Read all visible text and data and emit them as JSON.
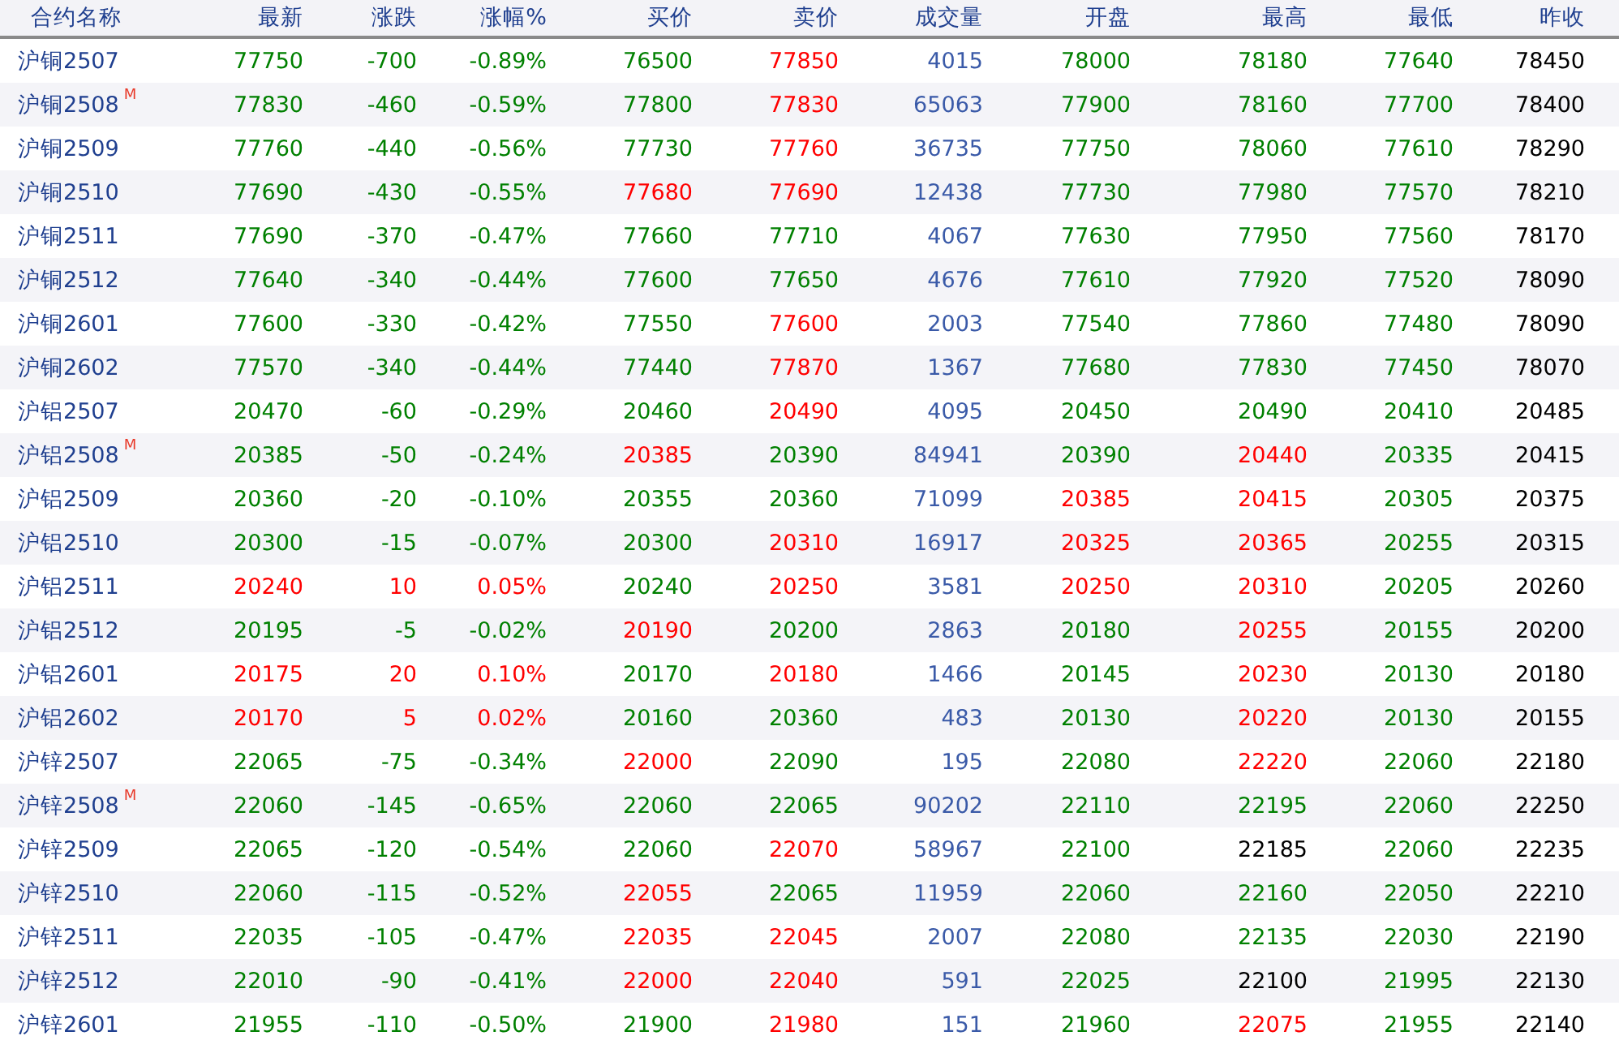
{
  "table": {
    "columns": [
      {
        "label": "合约名称",
        "kind": "name"
      },
      {
        "label": "最新",
        "kind": "value"
      },
      {
        "label": "涨跌",
        "kind": "value"
      },
      {
        "label": "涨幅%",
        "kind": "value"
      },
      {
        "label": "买价",
        "kind": "value"
      },
      {
        "label": "卖价",
        "kind": "value"
      },
      {
        "label": "成交量",
        "kind": "value"
      },
      {
        "label": "开盘",
        "kind": "value"
      },
      {
        "label": "最高",
        "kind": "value"
      },
      {
        "label": "最低",
        "kind": "value"
      },
      {
        "label": "昨收",
        "kind": "value"
      }
    ],
    "rows": [
      {
        "cells": [
          {
            "text": "沪铜2507",
            "color": "#1f3f8f"
          },
          {
            "text": "77750",
            "color": "#008000"
          },
          {
            "text": "-700",
            "color": "#008000"
          },
          {
            "text": "-0.89%",
            "color": "#008000"
          },
          {
            "text": "76500",
            "color": "#008000"
          },
          {
            "text": "77850",
            "color": "#ff0000"
          },
          {
            "text": "4015",
            "color": "#3a5aa8"
          },
          {
            "text": "78000",
            "color": "#008000"
          },
          {
            "text": "78180",
            "color": "#008000"
          },
          {
            "text": "77640",
            "color": "#008000"
          },
          {
            "text": "78450",
            "color": "#000000"
          }
        ]
      },
      {
        "badge": "M",
        "cells": [
          {
            "text": "沪铜2508",
            "color": "#1f3f8f"
          },
          {
            "text": "77830",
            "color": "#008000"
          },
          {
            "text": "-460",
            "color": "#008000"
          },
          {
            "text": "-0.59%",
            "color": "#008000"
          },
          {
            "text": "77800",
            "color": "#008000"
          },
          {
            "text": "77830",
            "color": "#ff0000"
          },
          {
            "text": "65063",
            "color": "#3a5aa8"
          },
          {
            "text": "77900",
            "color": "#008000"
          },
          {
            "text": "78160",
            "color": "#008000"
          },
          {
            "text": "77700",
            "color": "#008000"
          },
          {
            "text": "78400",
            "color": "#000000"
          }
        ]
      },
      {
        "cells": [
          {
            "text": "沪铜2509",
            "color": "#1f3f8f"
          },
          {
            "text": "77760",
            "color": "#008000"
          },
          {
            "text": "-440",
            "color": "#008000"
          },
          {
            "text": "-0.56%",
            "color": "#008000"
          },
          {
            "text": "77730",
            "color": "#008000"
          },
          {
            "text": "77760",
            "color": "#ff0000"
          },
          {
            "text": "36735",
            "color": "#3a5aa8"
          },
          {
            "text": "77750",
            "color": "#008000"
          },
          {
            "text": "78060",
            "color": "#008000"
          },
          {
            "text": "77610",
            "color": "#008000"
          },
          {
            "text": "78290",
            "color": "#000000"
          }
        ]
      },
      {
        "cells": [
          {
            "text": "沪铜2510",
            "color": "#1f3f8f"
          },
          {
            "text": "77690",
            "color": "#008000"
          },
          {
            "text": "-430",
            "color": "#008000"
          },
          {
            "text": "-0.55%",
            "color": "#008000"
          },
          {
            "text": "77680",
            "color": "#ff0000"
          },
          {
            "text": "77690",
            "color": "#ff0000"
          },
          {
            "text": "12438",
            "color": "#3a5aa8"
          },
          {
            "text": "77730",
            "color": "#008000"
          },
          {
            "text": "77980",
            "color": "#008000"
          },
          {
            "text": "77570",
            "color": "#008000"
          },
          {
            "text": "78210",
            "color": "#000000"
          }
        ]
      },
      {
        "cells": [
          {
            "text": "沪铜2511",
            "color": "#1f3f8f"
          },
          {
            "text": "77690",
            "color": "#008000"
          },
          {
            "text": "-370",
            "color": "#008000"
          },
          {
            "text": "-0.47%",
            "color": "#008000"
          },
          {
            "text": "77660",
            "color": "#008000"
          },
          {
            "text": "77710",
            "color": "#008000"
          },
          {
            "text": "4067",
            "color": "#3a5aa8"
          },
          {
            "text": "77630",
            "color": "#008000"
          },
          {
            "text": "77950",
            "color": "#008000"
          },
          {
            "text": "77560",
            "color": "#008000"
          },
          {
            "text": "78170",
            "color": "#000000"
          }
        ]
      },
      {
        "cells": [
          {
            "text": "沪铜2512",
            "color": "#1f3f8f"
          },
          {
            "text": "77640",
            "color": "#008000"
          },
          {
            "text": "-340",
            "color": "#008000"
          },
          {
            "text": "-0.44%",
            "color": "#008000"
          },
          {
            "text": "77600",
            "color": "#008000"
          },
          {
            "text": "77650",
            "color": "#008000"
          },
          {
            "text": "4676",
            "color": "#3a5aa8"
          },
          {
            "text": "77610",
            "color": "#008000"
          },
          {
            "text": "77920",
            "color": "#008000"
          },
          {
            "text": "77520",
            "color": "#008000"
          },
          {
            "text": "78090",
            "color": "#000000"
          }
        ]
      },
      {
        "cells": [
          {
            "text": "沪铜2601",
            "color": "#1f3f8f"
          },
          {
            "text": "77600",
            "color": "#008000"
          },
          {
            "text": "-330",
            "color": "#008000"
          },
          {
            "text": "-0.42%",
            "color": "#008000"
          },
          {
            "text": "77550",
            "color": "#008000"
          },
          {
            "text": "77600",
            "color": "#ff0000"
          },
          {
            "text": "2003",
            "color": "#3a5aa8"
          },
          {
            "text": "77540",
            "color": "#008000"
          },
          {
            "text": "77860",
            "color": "#008000"
          },
          {
            "text": "77480",
            "color": "#008000"
          },
          {
            "text": "78090",
            "color": "#000000"
          }
        ]
      },
      {
        "cells": [
          {
            "text": "沪铜2602",
            "color": "#1f3f8f"
          },
          {
            "text": "77570",
            "color": "#008000"
          },
          {
            "text": "-340",
            "color": "#008000"
          },
          {
            "text": "-0.44%",
            "color": "#008000"
          },
          {
            "text": "77440",
            "color": "#008000"
          },
          {
            "text": "77870",
            "color": "#ff0000"
          },
          {
            "text": "1367",
            "color": "#3a5aa8"
          },
          {
            "text": "77680",
            "color": "#008000"
          },
          {
            "text": "77830",
            "color": "#008000"
          },
          {
            "text": "77450",
            "color": "#008000"
          },
          {
            "text": "78070",
            "color": "#000000"
          }
        ]
      },
      {
        "cells": [
          {
            "text": "沪铝2507",
            "color": "#1f3f8f"
          },
          {
            "text": "20470",
            "color": "#008000"
          },
          {
            "text": "-60",
            "color": "#008000"
          },
          {
            "text": "-0.29%",
            "color": "#008000"
          },
          {
            "text": "20460",
            "color": "#008000"
          },
          {
            "text": "20490",
            "color": "#ff0000"
          },
          {
            "text": "4095",
            "color": "#3a5aa8"
          },
          {
            "text": "20450",
            "color": "#008000"
          },
          {
            "text": "20490",
            "color": "#008000"
          },
          {
            "text": "20410",
            "color": "#008000"
          },
          {
            "text": "20485",
            "color": "#000000"
          }
        ]
      },
      {
        "badge": "M",
        "cells": [
          {
            "text": "沪铝2508",
            "color": "#1f3f8f"
          },
          {
            "text": "20385",
            "color": "#008000"
          },
          {
            "text": "-50",
            "color": "#008000"
          },
          {
            "text": "-0.24%",
            "color": "#008000"
          },
          {
            "text": "20385",
            "color": "#ff0000"
          },
          {
            "text": "20390",
            "color": "#008000"
          },
          {
            "text": "84941",
            "color": "#3a5aa8"
          },
          {
            "text": "20390",
            "color": "#008000"
          },
          {
            "text": "20440",
            "color": "#ff0000"
          },
          {
            "text": "20335",
            "color": "#008000"
          },
          {
            "text": "20415",
            "color": "#000000"
          }
        ]
      },
      {
        "cells": [
          {
            "text": "沪铝2509",
            "color": "#1f3f8f"
          },
          {
            "text": "20360",
            "color": "#008000"
          },
          {
            "text": "-20",
            "color": "#008000"
          },
          {
            "text": "-0.10%",
            "color": "#008000"
          },
          {
            "text": "20355",
            "color": "#008000"
          },
          {
            "text": "20360",
            "color": "#008000"
          },
          {
            "text": "71099",
            "color": "#3a5aa8"
          },
          {
            "text": "20385",
            "color": "#ff0000"
          },
          {
            "text": "20415",
            "color": "#ff0000"
          },
          {
            "text": "20305",
            "color": "#008000"
          },
          {
            "text": "20375",
            "color": "#000000"
          }
        ]
      },
      {
        "cells": [
          {
            "text": "沪铝2510",
            "color": "#1f3f8f"
          },
          {
            "text": "20300",
            "color": "#008000"
          },
          {
            "text": "-15",
            "color": "#008000"
          },
          {
            "text": "-0.07%",
            "color": "#008000"
          },
          {
            "text": "20300",
            "color": "#008000"
          },
          {
            "text": "20310",
            "color": "#ff0000"
          },
          {
            "text": "16917",
            "color": "#3a5aa8"
          },
          {
            "text": "20325",
            "color": "#ff0000"
          },
          {
            "text": "20365",
            "color": "#ff0000"
          },
          {
            "text": "20255",
            "color": "#008000"
          },
          {
            "text": "20315",
            "color": "#000000"
          }
        ]
      },
      {
        "cells": [
          {
            "text": "沪铝2511",
            "color": "#1f3f8f"
          },
          {
            "text": "20240",
            "color": "#ff0000"
          },
          {
            "text": "10",
            "color": "#ff0000"
          },
          {
            "text": "0.05%",
            "color": "#ff0000"
          },
          {
            "text": "20240",
            "color": "#008000"
          },
          {
            "text": "20250",
            "color": "#ff0000"
          },
          {
            "text": "3581",
            "color": "#3a5aa8"
          },
          {
            "text": "20250",
            "color": "#ff0000"
          },
          {
            "text": "20310",
            "color": "#ff0000"
          },
          {
            "text": "20205",
            "color": "#008000"
          },
          {
            "text": "20260",
            "color": "#000000"
          }
        ]
      },
      {
        "cells": [
          {
            "text": "沪铝2512",
            "color": "#1f3f8f"
          },
          {
            "text": "20195",
            "color": "#008000"
          },
          {
            "text": "-5",
            "color": "#008000"
          },
          {
            "text": "-0.02%",
            "color": "#008000"
          },
          {
            "text": "20190",
            "color": "#ff0000"
          },
          {
            "text": "20200",
            "color": "#008000"
          },
          {
            "text": "2863",
            "color": "#3a5aa8"
          },
          {
            "text": "20180",
            "color": "#008000"
          },
          {
            "text": "20255",
            "color": "#ff0000"
          },
          {
            "text": "20155",
            "color": "#008000"
          },
          {
            "text": "20200",
            "color": "#000000"
          }
        ]
      },
      {
        "cells": [
          {
            "text": "沪铝2601",
            "color": "#1f3f8f"
          },
          {
            "text": "20175",
            "color": "#ff0000"
          },
          {
            "text": "20",
            "color": "#ff0000"
          },
          {
            "text": "0.10%",
            "color": "#ff0000"
          },
          {
            "text": "20170",
            "color": "#008000"
          },
          {
            "text": "20180",
            "color": "#ff0000"
          },
          {
            "text": "1466",
            "color": "#3a5aa8"
          },
          {
            "text": "20145",
            "color": "#008000"
          },
          {
            "text": "20230",
            "color": "#ff0000"
          },
          {
            "text": "20130",
            "color": "#008000"
          },
          {
            "text": "20180",
            "color": "#000000"
          }
        ]
      },
      {
        "cells": [
          {
            "text": "沪铝2602",
            "color": "#1f3f8f"
          },
          {
            "text": "20170",
            "color": "#ff0000"
          },
          {
            "text": "5",
            "color": "#ff0000"
          },
          {
            "text": "0.02%",
            "color": "#ff0000"
          },
          {
            "text": "20160",
            "color": "#008000"
          },
          {
            "text": "20360",
            "color": "#008000"
          },
          {
            "text": "483",
            "color": "#3a5aa8"
          },
          {
            "text": "20130",
            "color": "#008000"
          },
          {
            "text": "20220",
            "color": "#ff0000"
          },
          {
            "text": "20130",
            "color": "#008000"
          },
          {
            "text": "20155",
            "color": "#000000"
          }
        ]
      },
      {
        "cells": [
          {
            "text": "沪锌2507",
            "color": "#1f3f8f"
          },
          {
            "text": "22065",
            "color": "#008000"
          },
          {
            "text": "-75",
            "color": "#008000"
          },
          {
            "text": "-0.34%",
            "color": "#008000"
          },
          {
            "text": "22000",
            "color": "#ff0000"
          },
          {
            "text": "22090",
            "color": "#008000"
          },
          {
            "text": "195",
            "color": "#3a5aa8"
          },
          {
            "text": "22080",
            "color": "#008000"
          },
          {
            "text": "22220",
            "color": "#ff0000"
          },
          {
            "text": "22060",
            "color": "#008000"
          },
          {
            "text": "22180",
            "color": "#000000"
          }
        ]
      },
      {
        "badge": "M",
        "cells": [
          {
            "text": "沪锌2508",
            "color": "#1f3f8f"
          },
          {
            "text": "22060",
            "color": "#008000"
          },
          {
            "text": "-145",
            "color": "#008000"
          },
          {
            "text": "-0.65%",
            "color": "#008000"
          },
          {
            "text": "22060",
            "color": "#008000"
          },
          {
            "text": "22065",
            "color": "#008000"
          },
          {
            "text": "90202",
            "color": "#3a5aa8"
          },
          {
            "text": "22110",
            "color": "#008000"
          },
          {
            "text": "22195",
            "color": "#008000"
          },
          {
            "text": "22060",
            "color": "#008000"
          },
          {
            "text": "22250",
            "color": "#000000"
          }
        ]
      },
      {
        "cells": [
          {
            "text": "沪锌2509",
            "color": "#1f3f8f"
          },
          {
            "text": "22065",
            "color": "#008000"
          },
          {
            "text": "-120",
            "color": "#008000"
          },
          {
            "text": "-0.54%",
            "color": "#008000"
          },
          {
            "text": "22060",
            "color": "#008000"
          },
          {
            "text": "22070",
            "color": "#ff0000"
          },
          {
            "text": "58967",
            "color": "#3a5aa8"
          },
          {
            "text": "22100",
            "color": "#008000"
          },
          {
            "text": "22185",
            "color": "#000000"
          },
          {
            "text": "22060",
            "color": "#008000"
          },
          {
            "text": "22235",
            "color": "#000000"
          }
        ]
      },
      {
        "cells": [
          {
            "text": "沪锌2510",
            "color": "#1f3f8f"
          },
          {
            "text": "22060",
            "color": "#008000"
          },
          {
            "text": "-115",
            "color": "#008000"
          },
          {
            "text": "-0.52%",
            "color": "#008000"
          },
          {
            "text": "22055",
            "color": "#ff0000"
          },
          {
            "text": "22065",
            "color": "#008000"
          },
          {
            "text": "11959",
            "color": "#3a5aa8"
          },
          {
            "text": "22060",
            "color": "#008000"
          },
          {
            "text": "22160",
            "color": "#008000"
          },
          {
            "text": "22050",
            "color": "#008000"
          },
          {
            "text": "22210",
            "color": "#000000"
          }
        ]
      },
      {
        "cells": [
          {
            "text": "沪锌2511",
            "color": "#1f3f8f"
          },
          {
            "text": "22035",
            "color": "#008000"
          },
          {
            "text": "-105",
            "color": "#008000"
          },
          {
            "text": "-0.47%",
            "color": "#008000"
          },
          {
            "text": "22035",
            "color": "#ff0000"
          },
          {
            "text": "22045",
            "color": "#ff0000"
          },
          {
            "text": "2007",
            "color": "#3a5aa8"
          },
          {
            "text": "22080",
            "color": "#008000"
          },
          {
            "text": "22135",
            "color": "#008000"
          },
          {
            "text": "22030",
            "color": "#008000"
          },
          {
            "text": "22190",
            "color": "#000000"
          }
        ]
      },
      {
        "cells": [
          {
            "text": "沪锌2512",
            "color": "#1f3f8f"
          },
          {
            "text": "22010",
            "color": "#008000"
          },
          {
            "text": "-90",
            "color": "#008000"
          },
          {
            "text": "-0.41%",
            "color": "#008000"
          },
          {
            "text": "22000",
            "color": "#ff0000"
          },
          {
            "text": "22040",
            "color": "#ff0000"
          },
          {
            "text": "591",
            "color": "#3a5aa8"
          },
          {
            "text": "22025",
            "color": "#008000"
          },
          {
            "text": "22100",
            "color": "#000000"
          },
          {
            "text": "21995",
            "color": "#008000"
          },
          {
            "text": "22130",
            "color": "#000000"
          }
        ]
      },
      {
        "cells": [
          {
            "text": "沪锌2601",
            "color": "#1f3f8f"
          },
          {
            "text": "21955",
            "color": "#008000"
          },
          {
            "text": "-110",
            "color": "#008000"
          },
          {
            "text": "-0.50%",
            "color": "#008000"
          },
          {
            "text": "21900",
            "color": "#008000"
          },
          {
            "text": "21980",
            "color": "#ff0000"
          },
          {
            "text": "151",
            "color": "#3a5aa8"
          },
          {
            "text": "21960",
            "color": "#008000"
          },
          {
            "text": "22075",
            "color": "#ff0000"
          },
          {
            "text": "21955",
            "color": "#008000"
          },
          {
            "text": "22140",
            "color": "#000000"
          }
        ]
      }
    ]
  }
}
